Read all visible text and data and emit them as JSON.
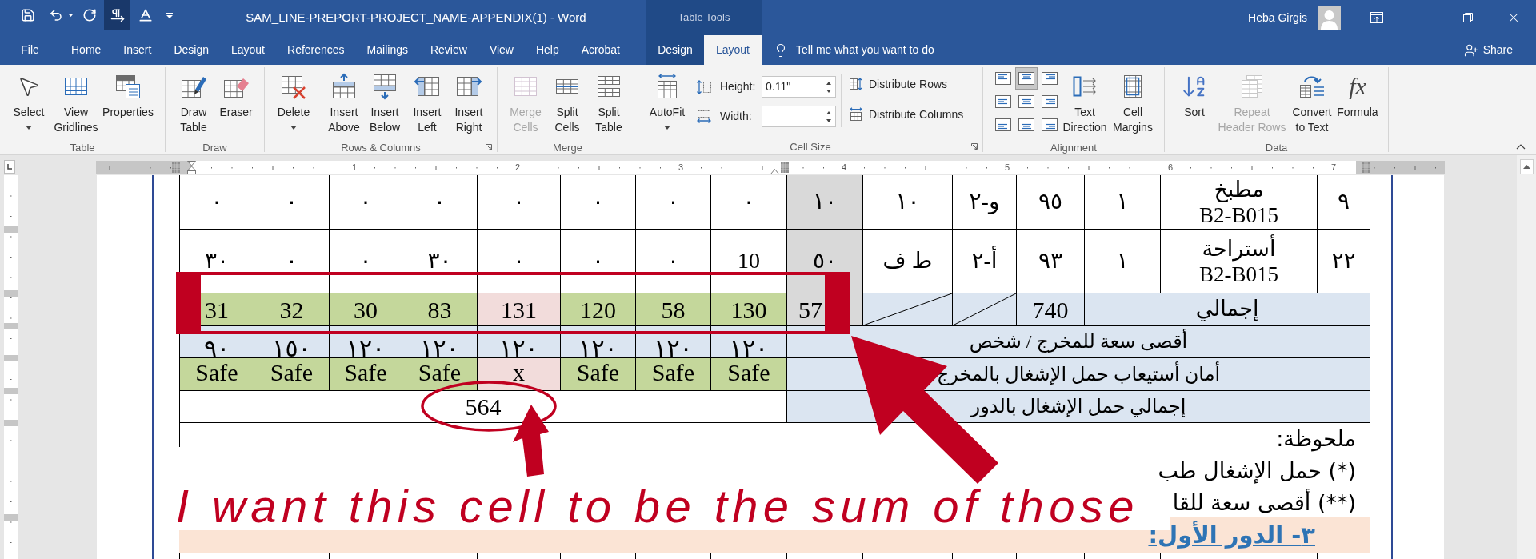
{
  "quick_access": [
    {
      "on": false
    },
    {
      "on": false
    },
    {
      "on": false
    },
    {
      "on": false
    },
    {
      "on": true
    },
    {
      "on": false
    },
    {
      "on": false
    }
  ],
  "window": {
    "title": "SAM_LINE-PREPORT-PROJECT_NAME-APPENDIX(1) - Word",
    "context_label": "Table Tools",
    "user": "Heba Girgis"
  },
  "tabs": [
    {
      "label": "File",
      "selected": false,
      "contextual": false
    },
    {
      "label": "Home",
      "selected": false,
      "contextual": false
    },
    {
      "label": "Insert",
      "selected": false,
      "contextual": false
    },
    {
      "label": "Design",
      "selected": false,
      "contextual": false
    },
    {
      "label": "Layout",
      "selected": false,
      "contextual": false
    },
    {
      "label": "References",
      "selected": false,
      "contextual": false
    },
    {
      "label": "Mailings",
      "selected": false,
      "contextual": false
    },
    {
      "label": "Review",
      "selected": false,
      "contextual": false
    },
    {
      "label": "View",
      "selected": false,
      "contextual": false
    },
    {
      "label": "Help",
      "selected": false,
      "contextual": false
    },
    {
      "label": "Acrobat",
      "selected": false,
      "contextual": false
    },
    {
      "label": "Design",
      "selected": false,
      "contextual": true
    },
    {
      "label": "Layout",
      "selected": true,
      "contextual": true
    }
  ],
  "tell_me": {
    "placeholder": "Tell me what you want to do"
  },
  "share": {
    "label": "Share"
  },
  "ribbon": [
    {
      "label": "Table",
      "launcher": false,
      "items": [
        {
          "kind": "menu",
          "lines": [
            "Select"
          ],
          "disabled": false
        },
        {
          "kind": "button",
          "lines": [
            "View",
            "Gridlines"
          ],
          "disabled": false
        },
        {
          "kind": "button",
          "lines": [
            "Properties"
          ],
          "disabled": false
        }
      ]
    },
    {
      "label": "Draw",
      "launcher": false,
      "items": [
        {
          "kind": "button",
          "lines": [
            "Draw",
            "Table"
          ],
          "disabled": false
        },
        {
          "kind": "button",
          "lines": [
            "Eraser"
          ],
          "disabled": false
        }
      ]
    },
    {
      "label": "Rows & Columns",
      "launcher": true,
      "items": [
        {
          "kind": "menu",
          "lines": [
            "Delete"
          ],
          "disabled": false
        },
        {
          "kind": "button",
          "lines": [
            "Insert",
            "Above"
          ],
          "disabled": false
        },
        {
          "kind": "button",
          "lines": [
            "Insert",
            "Below"
          ],
          "disabled": false
        },
        {
          "kind": "button",
          "lines": [
            "Insert",
            "Left"
          ],
          "disabled": false
        },
        {
          "kind": "button",
          "lines": [
            "Insert",
            "Right"
          ],
          "disabled": false
        }
      ]
    },
    {
      "label": "Merge",
      "launcher": false,
      "items": [
        {
          "kind": "button",
          "lines": [
            "Merge",
            "Cells"
          ],
          "disabled": true
        },
        {
          "kind": "button",
          "lines": [
            "Split",
            "Cells"
          ],
          "disabled": false
        },
        {
          "kind": "button",
          "lines": [
            "Split",
            "Table"
          ],
          "disabled": false
        }
      ]
    },
    {
      "label": "Cell Size",
      "launcher": true,
      "items": [
        {
          "kind": "menu",
          "lines": [
            "AutoFit"
          ],
          "disabled": false
        },
        {
          "kind": "spin_field",
          "label": "Height:",
          "value": "0.11\"",
          "disabled": false
        },
        {
          "kind": "spin_field",
          "label": "Width:",
          "disabled": false
        },
        {
          "kind": "small",
          "label": "Distribute Rows",
          "disabled": false
        },
        {
          "kind": "small",
          "label": "Distribute Columns",
          "disabled": false
        }
      ]
    },
    {
      "label": "Alignment",
      "launcher": false,
      "items": [
        {
          "kind": "align",
          "selected": false,
          "disabled": false
        },
        {
          "kind": "align",
          "selected": true,
          "disabled": false
        },
        {
          "kind": "align",
          "selected": false,
          "disabled": false
        },
        {
          "kind": "align",
          "selected": false,
          "disabled": false
        },
        {
          "kind": "align",
          "selected": false,
          "disabled": false
        },
        {
          "kind": "align",
          "selected": false,
          "disabled": false
        },
        {
          "kind": "align",
          "selected": false,
          "disabled": false
        },
        {
          "kind": "align",
          "selected": false,
          "disabled": false
        },
        {
          "kind": "align",
          "selected": false,
          "disabled": false
        },
        {
          "kind": "button",
          "lines": [
            "Text",
            "Direction"
          ],
          "disabled": false
        },
        {
          "kind": "button",
          "lines": [
            "Cell",
            "Margins"
          ],
          "disabled": false
        }
      ]
    },
    {
      "label": "Data",
      "launcher": false,
      "items": [
        {
          "kind": "button",
          "lines": [
            "Sort"
          ],
          "disabled": false
        },
        {
          "kind": "button",
          "lines": [
            "Repeat",
            "Header Rows"
          ],
          "disabled": true
        },
        {
          "kind": "button",
          "lines": [
            "Convert",
            "to Text"
          ],
          "disabled": false
        },
        {
          "kind": "button",
          "lines": [
            "Formula"
          ],
          "glyph": "fx",
          "disabled": false
        }
      ]
    }
  ],
  "ruler": {
    "numbers": [
      "1",
      "2",
      "3",
      "4",
      "5",
      "6",
      "7"
    ]
  },
  "table": {
    "rows": [
      {
        "kind": "data",
        "cells": [
          {
            "text": "٩"
          },
          {
            "lines": [
              "مطبخ",
              "B2-B015"
            ]
          },
          {
            "text": "١"
          },
          {
            "text": "٩٥"
          },
          {
            "text": "و-٢"
          },
          {
            "text": "١٠"
          },
          {
            "text": "١٠",
            "color": "#d9d9d9"
          },
          {
            "text": "٠"
          },
          {
            "text": "٠"
          },
          {
            "text": "٠"
          },
          {
            "text": "٠"
          },
          {
            "text": "٠"
          },
          {
            "text": "٠"
          },
          {
            "text": "٠"
          },
          {
            "text": "٠"
          }
        ]
      },
      {
        "kind": "data",
        "cells": [
          {
            "text": "٢٢"
          },
          {
            "lines": [
              "أستراحة",
              "B2-B015"
            ]
          },
          {
            "text": "١"
          },
          {
            "text": "٩٣"
          },
          {
            "text": "أ-٢"
          },
          {
            "text": "ط ف"
          },
          {
            "text": "٥٠",
            "color": "#d9d9d9"
          },
          {
            "text": "10"
          },
          {
            "text": "٠"
          },
          {
            "text": "٠"
          },
          {
            "text": "٠"
          },
          {
            "text": "٣٠"
          },
          {
            "text": "٠"
          },
          {
            "text": "٠"
          },
          {
            "text": "٣٠"
          }
        ]
      },
      {
        "kind": "totals",
        "cells": [
          {
            "kind": "value",
            "text": "31",
            "color": "#c4d79b"
          },
          {
            "kind": "value",
            "text": "32",
            "color": "#c4d79b"
          },
          {
            "kind": "value",
            "text": "30",
            "color": "#c4d79b"
          },
          {
            "kind": "value",
            "text": "83",
            "color": "#c4d79b"
          },
          {
            "kind": "value",
            "text": "131",
            "color": "#f2dcdb"
          },
          {
            "kind": "value",
            "text": "120",
            "color": "#c4d79b"
          },
          {
            "kind": "value",
            "text": "58",
            "color": "#c4d79b"
          },
          {
            "kind": "value",
            "text": "130",
            "color": "#c4d79b"
          },
          {
            "kind": "value",
            "text": "57",
            "color": "#d9d9d9"
          },
          {
            "kind": "diagonal",
            "color": "#dbe5f1"
          },
          {
            "kind": "diagonal",
            "color": "#dbe5f1"
          },
          {
            "kind": "value",
            "text": "740",
            "color": "#dbe5f1"
          },
          {
            "kind": "label",
            "text": "إجمالي",
            "color": "#dbe5f1"
          }
        ]
      },
      {
        "kind": "check",
        "cells": [
          {
            "text": "أقصى سعة للمخرج / شخص",
            "color": "#dbe5f1"
          },
          {
            "text": "١٢٠",
            "color": "#dbe5f1"
          },
          {
            "text": "١٢٠",
            "color": "#dbe5f1"
          },
          {
            "text": "١٢٠",
            "color": "#dbe5f1"
          },
          {
            "text": "١٢٠",
            "color": "#dbe5f1"
          },
          {
            "text": "١٢٠",
            "color": "#dbe5f1"
          },
          {
            "text": "١٢٠",
            "color": "#dbe5f1"
          },
          {
            "text": "١٥٠",
            "color": "#dbe5f1"
          },
          {
            "text": "٩٠",
            "color": "#dbe5f1"
          }
        ]
      },
      {
        "kind": "check",
        "cells": [
          {
            "text": "Safe",
            "color": "#c4d79b"
          },
          {
            "text": "Safe",
            "color": "#c4d79b"
          },
          {
            "text": "Safe",
            "color": "#c4d79b"
          },
          {
            "text": "Safe",
            "color": "#c4d79b"
          },
          {
            "text": "x",
            "color": "#f2dcdb"
          },
          {
            "text": "Safe",
            "color": "#c4d79b"
          },
          {
            "text": "Safe",
            "color": "#c4d79b"
          },
          {
            "text": "Safe",
            "color": "#c4d79b"
          },
          {
            "text": "أمان أستيعاب حمل الإشغال بالمخرج",
            "color": "#dbe5f1"
          }
        ]
      },
      {
        "kind": "sum",
        "cells": [
          {
            "text": "564"
          },
          {
            "text": "إجمالي حمل الإشغال بالدور",
            "color": "#dbe5f1"
          }
        ]
      },
      {
        "kind": "note",
        "lines": [
          "ملحوظة:",
          "(*) حمل الإشغال طب",
          "(**) أقصى سعة للقا"
        ]
      },
      {
        "kind": "heading",
        "text": "٣- الدور الأول:"
      }
    ]
  },
  "annotation": {
    "caption": "I want this cell to be the sum of those"
  }
}
